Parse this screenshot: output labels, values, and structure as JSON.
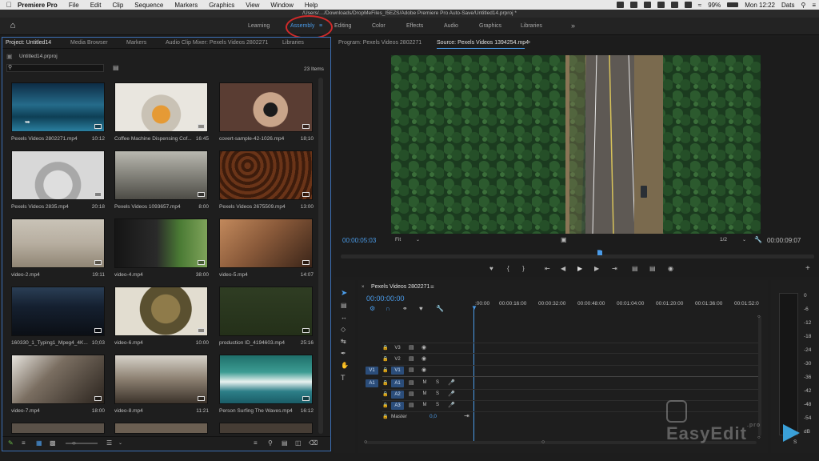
{
  "menubar": {
    "app": "Premiere Pro",
    "items": [
      "File",
      "Edit",
      "Clip",
      "Sequence",
      "Markers",
      "Graphics",
      "View",
      "Window",
      "Help"
    ],
    "battery": "99%",
    "clock": "Mon 12:22",
    "user": "Dats"
  },
  "title": "/Users/…/Downloads/DropMeFiles_I5EZS/Adobe Premiere Pro Auto-Save/Untitled14.prproj *",
  "workspaces": [
    "Learning",
    "Assembly",
    "Editing",
    "Color",
    "Effects",
    "Audio",
    "Graphics",
    "Libraries"
  ],
  "workspace_more": "»",
  "project_panel": {
    "tabs": [
      "Project: Untitled14",
      "Media Browser",
      "Markers",
      "Audio Clip Mixer: Pexels Videos 2802271",
      "Libraries"
    ],
    "path": "Untitled14.prproj",
    "item_count": "23 Items",
    "clips": [
      {
        "name": "Pexels Videos 2802271.mp4",
        "duration": "10:12"
      },
      {
        "name": "Coffee Machine Dispensing Cof...",
        "duration": "16:45"
      },
      {
        "name": "covert-sample-42-1026.mp4",
        "duration": "18;10"
      },
      {
        "name": "Pexels Videos 2835.mp4",
        "duration": "20:18"
      },
      {
        "name": "Pexels Videos 1093657.mp4",
        "duration": "8:00"
      },
      {
        "name": "Pexels Videos 2675509.mp4",
        "duration": "13:00"
      },
      {
        "name": "video-2.mp4",
        "duration": "19:11"
      },
      {
        "name": "video-4.mp4",
        "duration": "38:00"
      },
      {
        "name": "video-5.mp4",
        "duration": "14:07"
      },
      {
        "name": "160330_1_Typing1_Mpeg4_4K...",
        "duration": "10;03"
      },
      {
        "name": "video-6.mp4",
        "duration": "10:00"
      },
      {
        "name": "production ID_4194603.mp4",
        "duration": "25:16"
      },
      {
        "name": "video-7.mp4",
        "duration": "18:00"
      },
      {
        "name": "video-8.mp4",
        "duration": "11:21"
      },
      {
        "name": "Person Surfing The Waves.mp4",
        "duration": "16:12"
      }
    ]
  },
  "monitors": {
    "program_tab": "Program: Pexels Videos 2802271",
    "source_tab": "Source: Pexels Videos 1394254.mp4",
    "timecode_left": "00:00:05:03",
    "fit": "Fit",
    "scale": "1/2",
    "timecode_right": "00:00:09:07"
  },
  "timeline": {
    "sequence_tab": "Pexels Videos 2802271",
    "timecode": "00:00:00:00",
    "ruler": [
      ":00:00",
      "00:00:16:00",
      "00:00:32:00",
      "00:00:48:00",
      "00:01:04:00",
      "00:01:20:00",
      "00:01:36:00",
      "00:01:52:0"
    ],
    "video_tracks": [
      "V3",
      "V2",
      "V1"
    ],
    "audio_tracks": [
      "A1",
      "A2",
      "A3"
    ],
    "src_v": "V1",
    "src_a": "A1",
    "master": "Master",
    "master_val": "0,0",
    "m_label": "M",
    "s_label": "S"
  },
  "meters": {
    "labels": [
      "0",
      "-6",
      "-12",
      "-18",
      "-24",
      "-30",
      "-36",
      "-42",
      "-48",
      "-54",
      "dB"
    ],
    "bottom_s": "S"
  },
  "watermark": "EasyEdit",
  "watermark_suffix": ".pro",
  "colors": {
    "accent": "#4a9be8",
    "highlight_circle": "#d02a2a"
  }
}
